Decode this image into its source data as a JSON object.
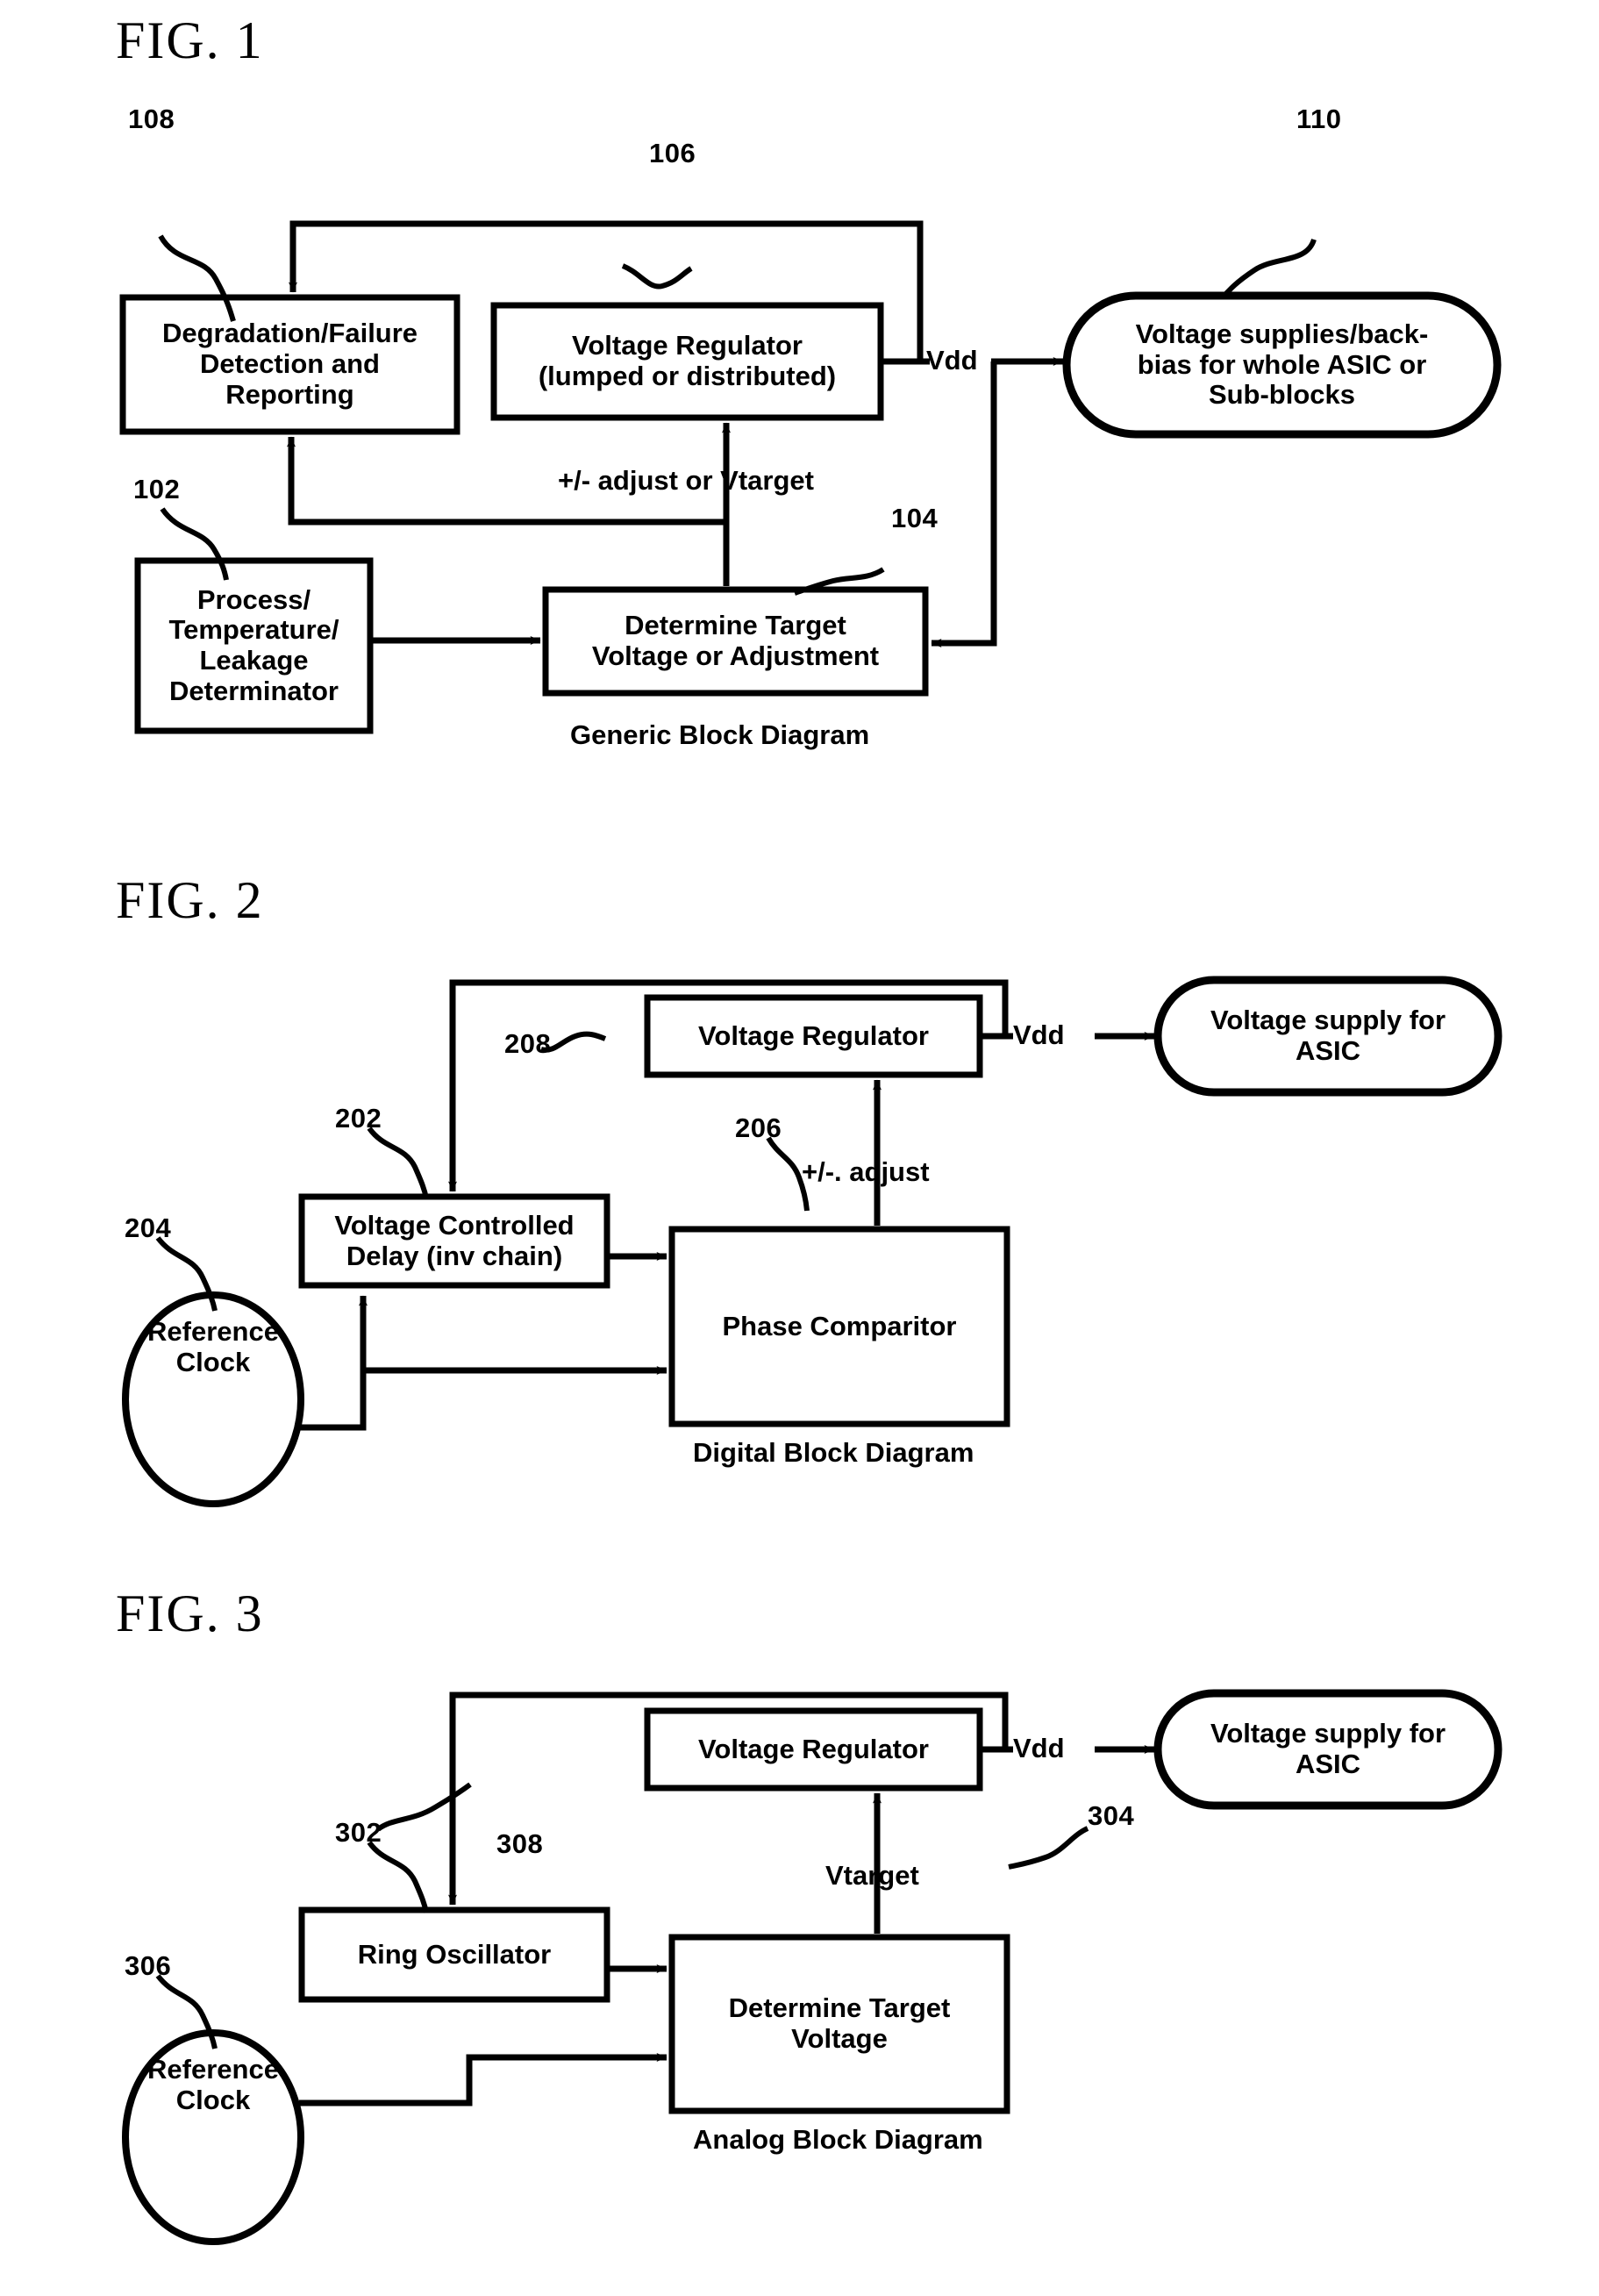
{
  "figures": [
    {
      "title": "FIG. 1",
      "caption": "Generic Block Diagram",
      "blocks": {
        "degradation": "Degradation/Failure\nDetection and\nReporting",
        "degradation_lines": [
          "Degradation/Failure",
          "Detection and",
          "Reporting"
        ],
        "regulator_lines": [
          "Voltage Regulator",
          "(lumped or distributed)"
        ],
        "supplies_lines": [
          "Voltage supplies/back-",
          "bias for whole ASIC or",
          "Sub-blocks"
        ],
        "process_lines": [
          "Process/",
          "Temperature/",
          "Leakage",
          "Determinator"
        ],
        "determine_lines": [
          "Determine Target",
          "Voltage or Adjustment"
        ]
      },
      "refs": {
        "r108": "108",
        "r106": "106",
        "r110": "110",
        "r102": "102",
        "r104": "104"
      },
      "signals": {
        "vdd": "Vdd",
        "adjust": "+/- adjust or Vtarget"
      }
    },
    {
      "title": "FIG. 2",
      "caption": "Digital Block Diagram",
      "blocks": {
        "regulator_lines": [
          "Voltage Regulator"
        ],
        "supply_lines": [
          "Voltage supply for",
          "ASIC"
        ],
        "vcd_lines": [
          "Voltage Controlled",
          "Delay (inv chain)"
        ],
        "phase_lines": [
          "Phase Comparitor"
        ],
        "refclock_lines": [
          "Reference",
          "Clock"
        ]
      },
      "refs": {
        "r208": "208",
        "r202": "202",
        "r204": "204",
        "r206": "206"
      },
      "signals": {
        "vdd": "Vdd",
        "adjust": "+/-. adjust"
      }
    },
    {
      "title": "FIG. 3",
      "caption": "Analog Block Diagram",
      "blocks": {
        "regulator_lines": [
          "Voltage Regulator"
        ],
        "supply_lines": [
          "Voltage supply for",
          "ASIC"
        ],
        "ring_lines": [
          "Ring Oscillator"
        ],
        "determine_lines": [
          "Determine Target",
          "Voltage"
        ],
        "refclock_lines": [
          "Reference",
          "Clock"
        ]
      },
      "refs": {
        "r302": "302",
        "r308": "308",
        "r306": "306",
        "r304": "304"
      },
      "signals": {
        "vdd": "Vdd",
        "vtarget": "Vtarget"
      }
    }
  ],
  "colors": {
    "ink": "#000000",
    "paper": "#ffffff"
  }
}
